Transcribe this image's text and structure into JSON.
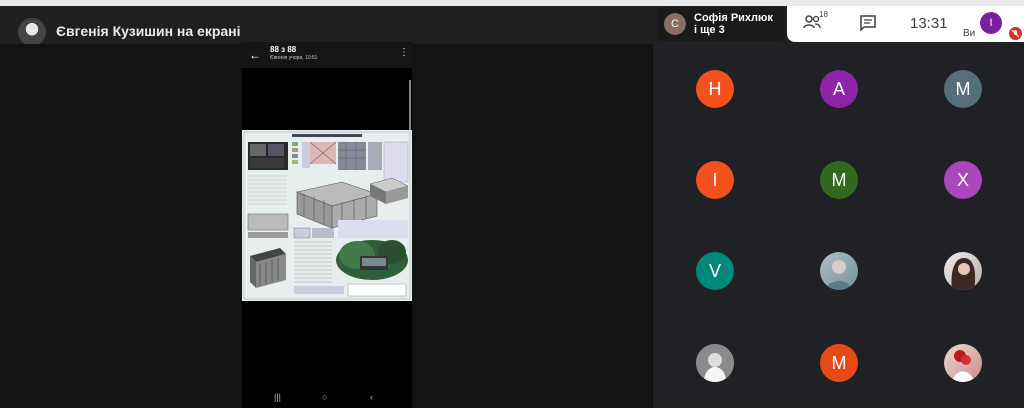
{
  "presenter": {
    "title": "Євгенія Кузишин на екрані",
    "avatar_icon": "user-photo-icon"
  },
  "phone": {
    "title": "88 з 88",
    "subtitle": "Євгенія учора, 10:51",
    "back_icon": "arrow-back-icon",
    "menu_icon": "more-vert-icon",
    "nav": {
      "recents": "|||",
      "home": "○",
      "back": "‹"
    }
  },
  "user_chip": {
    "initial": "С",
    "name_line1": "Софія Рихлюк",
    "name_line2": "і ще 3"
  },
  "controls": {
    "people_count": "18",
    "time": "13:31",
    "you_initial": "I",
    "you_label": "Ви",
    "you_color": "#7b1fa2",
    "mic_status": "muted"
  },
  "participants": [
    {
      "initial": "Н",
      "color": "#f4511e"
    },
    {
      "initial": "А",
      "color": "#8e24aa"
    },
    {
      "initial": "M",
      "color": "#546e7a"
    },
    {
      "initial": "І",
      "color": "#f4511e"
    },
    {
      "initial": "M",
      "color": "#33691e"
    },
    {
      "initial": "X",
      "color": "#ab47bc"
    },
    {
      "initial": "V",
      "color": "#00897b"
    },
    {
      "initial": "",
      "color": "#90a4ae",
      "photo": "participant-photo"
    },
    {
      "initial": "",
      "color": "#cfc7c2",
      "photo": "participant-photo"
    },
    {
      "initial": "",
      "color": "#9e9e9e",
      "photo": "participant-photo"
    },
    {
      "initial": "M",
      "color": "#e64a19"
    },
    {
      "initial": "",
      "color": "#e0b8b0",
      "photo": "participant-photo"
    }
  ]
}
